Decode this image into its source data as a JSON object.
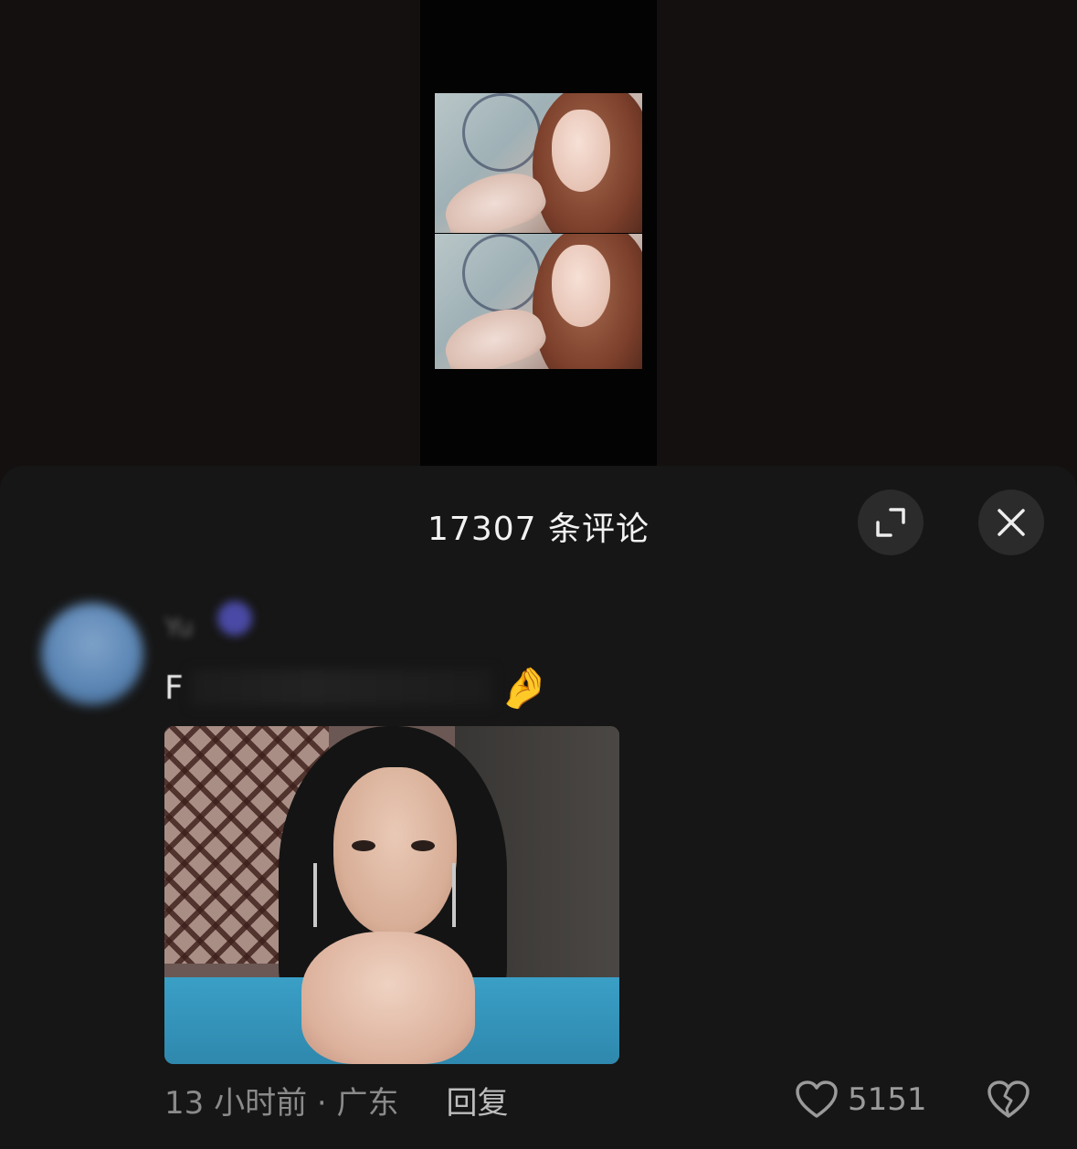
{
  "video": {
    "photos": [
      "photo-top",
      "photo-bottom"
    ]
  },
  "comments_panel": {
    "title": "17307 条评论",
    "expand_icon": "expand-icon",
    "close_icon": "close-icon"
  },
  "comment": {
    "username": "Yu",
    "text_visible": "F",
    "emoji": "🤌",
    "time_location": "13 小时前 · 广东",
    "reply_label": "回复",
    "like_count": "5151",
    "like_icon": "heart-icon",
    "dislike_icon": "broken-heart-icon"
  },
  "colors": {
    "background": "#141010",
    "sheet": "#161616",
    "button_bg": "#2b2b2b",
    "text_primary": "#f2f2f2",
    "text_secondary": "#8a8a8a"
  }
}
